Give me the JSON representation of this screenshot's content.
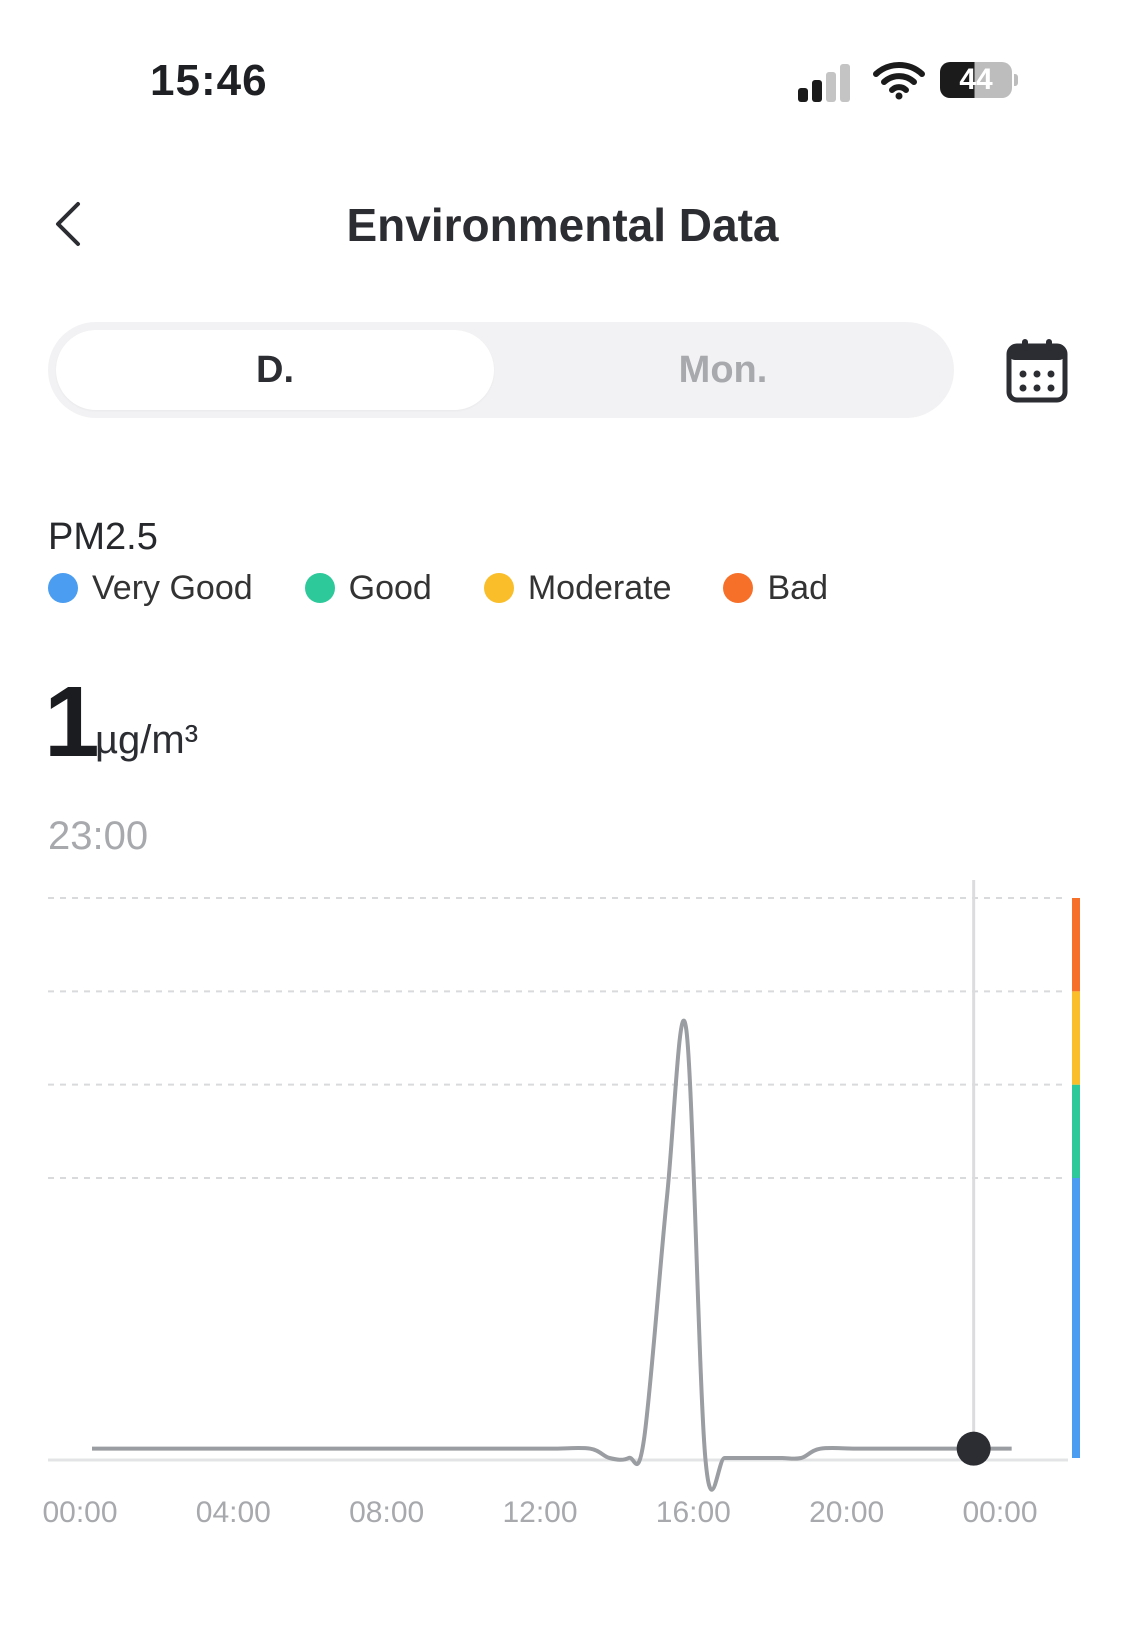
{
  "status_bar": {
    "time": "15:46",
    "battery": "44",
    "icons": [
      "signal-icon",
      "wifi-icon",
      "battery-icon"
    ]
  },
  "header": {
    "back_icon": "chevron-left-icon",
    "title": "Environmental Data"
  },
  "tabs": {
    "items": [
      {
        "label": "D.",
        "active": true
      },
      {
        "label": "Mon.",
        "active": false
      }
    ],
    "calendar_icon": "calendar-icon"
  },
  "metric": {
    "name": "PM2.5",
    "legend": [
      {
        "label": "Very Good",
        "color": "#4a9df0"
      },
      {
        "label": "Good",
        "color": "#2ec99a"
      },
      {
        "label": "Moderate",
        "color": "#f9be2a"
      },
      {
        "label": "Bad",
        "color": "#f7702a"
      }
    ],
    "value": "1",
    "unit": "µg/m³",
    "time": "23:00"
  },
  "chart_data": {
    "type": "line",
    "x_tick_labels": [
      "00:00",
      "04:00",
      "08:00",
      "12:00",
      "16:00",
      "20:00",
      "00:00"
    ],
    "xlim": [
      0,
      24
    ],
    "ylim": [
      0,
      60
    ],
    "grid": true,
    "x": [
      0,
      1,
      2,
      3,
      4,
      5,
      6,
      7,
      8,
      9,
      10,
      11,
      12,
      13,
      13.5,
      14,
      14.4,
      15,
      15.5,
      16,
      16.5,
      17,
      17.5,
      18,
      18.5,
      19,
      20,
      21,
      22,
      23
    ],
    "y": [
      1,
      1,
      1,
      1,
      1,
      1,
      1,
      1,
      1,
      1,
      1,
      1,
      1,
      1,
      0,
      0,
      2,
      28,
      46,
      0,
      0,
      0,
      0,
      0,
      0,
      1,
      1,
      1,
      1,
      1
    ],
    "series_color": "#9a9da1",
    "selected_index": 29,
    "level_bands": [
      {
        "from": 0,
        "to": 30,
        "color": "#4a9df0"
      },
      {
        "from": 30,
        "to": 40,
        "color": "#2ec99a"
      },
      {
        "from": 40,
        "to": 50,
        "color": "#f9be2a"
      },
      {
        "from": 50,
        "to": 60,
        "color": "#f7702a"
      }
    ]
  }
}
